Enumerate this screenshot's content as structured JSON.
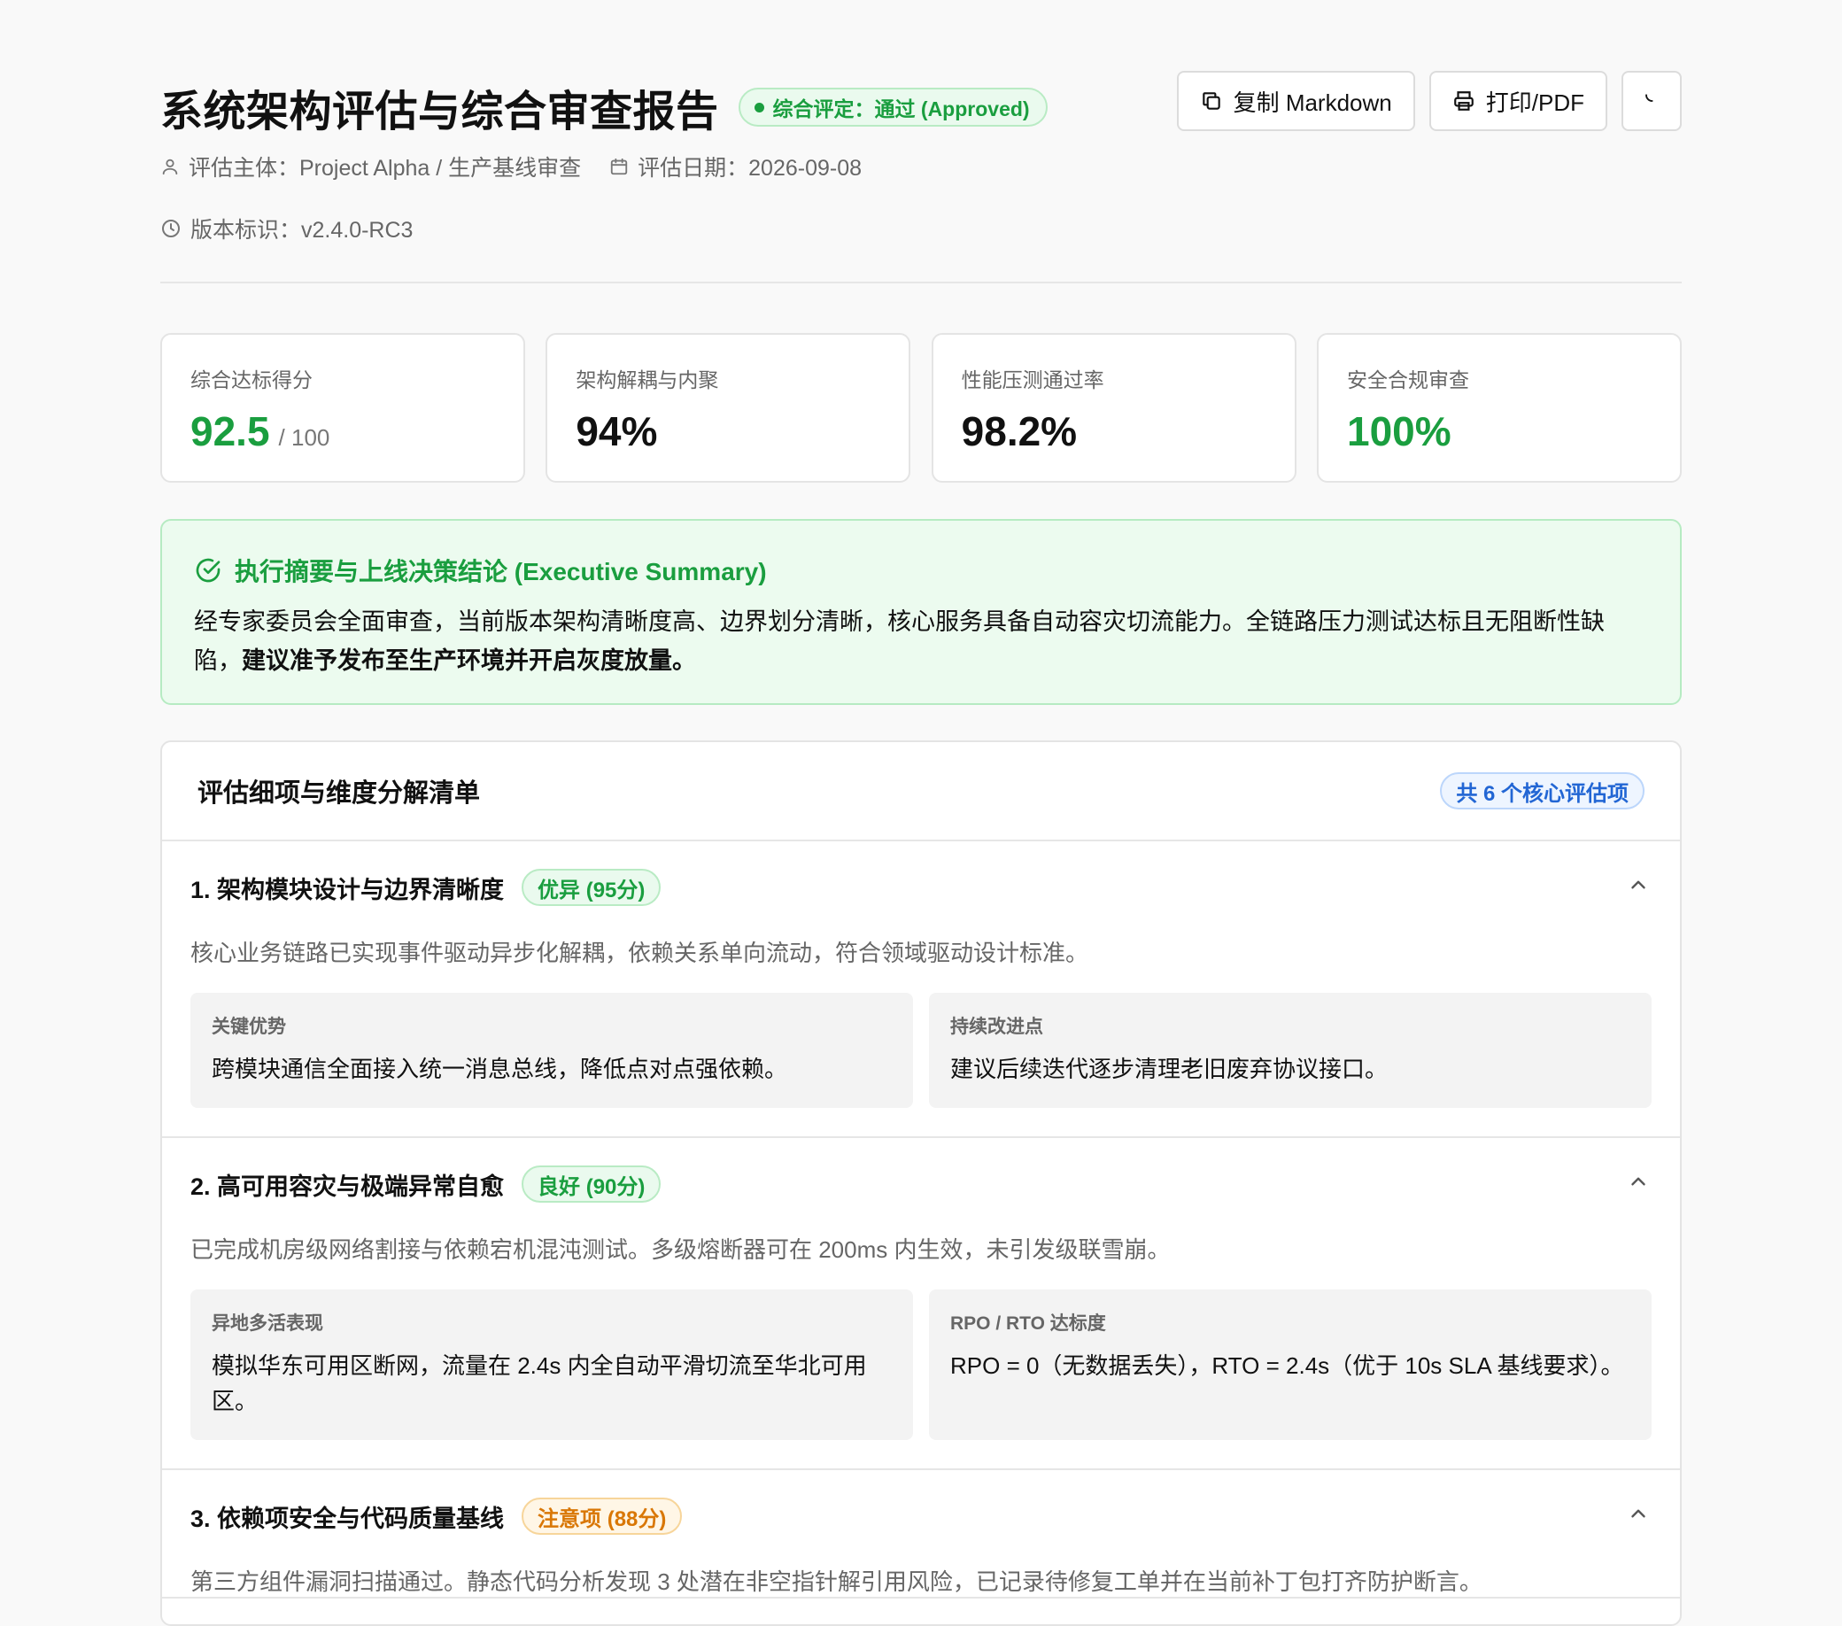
{
  "header": {
    "title": "系统架构评估与综合审查报告",
    "status": "综合评定：通过 (Approved)",
    "subject": "评估主体：Project Alpha / 生产基线审查",
    "date": "评估日期：2026-09-08",
    "version": "版本标识：v2.4.0-RC3",
    "copy_label": "复制 Markdown",
    "print_label": "打印/PDF"
  },
  "metrics": [
    {
      "label": "综合达标得分",
      "value": "92.5",
      "suffix": "/ 100"
    },
    {
      "label": "架构解耦与内聚",
      "value": "94%"
    },
    {
      "label": "性能压测通过率",
      "value": "98.2%"
    },
    {
      "label": "安全合规审查",
      "value": "100%"
    }
  ],
  "summary": {
    "title": "执行摘要与上线决策结论 (Executive Summary)",
    "text": "经专家委员会全面审查，当前版本架构清晰度高、边界划分清晰，核心服务具备自动容灾切流能力。全链路压力测试达标且无阻断性缺陷，",
    "emphasis": "建议准予发布至生产环境并开启灰度放量。"
  },
  "details": {
    "title": "评估细项与维度分解清单",
    "count": "共 6 个核心评估项",
    "items": [
      {
        "title": "1. 架构模块设计与边界清晰度",
        "grade": "优异 (95分)",
        "desc": "核心业务链路已实现事件驱动异步化解耦，依赖关系单向流动，符合领域驱动设计标准。",
        "left_label": "关键优势",
        "left_text": "跨模块通信全面接入统一消息总线，降低点对点强依赖。",
        "right_label": "持续改进点",
        "right_text": "建议后续迭代逐步清理老旧废弃协议接口。"
      },
      {
        "title": "2. 高可用容灾与极端异常自愈",
        "grade": "良好 (90分)",
        "desc": "已完成机房级网络割接与依赖宕机混沌测试。多级熔断器可在 200ms 内生效，未引发级联雪崩。",
        "left_label": "异地多活表现",
        "left_text": "模拟华东可用区断网，流量在 2.4s 内全自动平滑切流至华北可用区。",
        "right_label": "RPO / RTO 达标度",
        "right_text": "RPO = 0（无数据丢失），RTO = 2.4s（优于 10s SLA 基线要求）。"
      },
      {
        "title": "3. 依赖项安全与代码质量基线",
        "grade": "注意项 (88分)",
        "desc": "第三方组件漏洞扫描通过。静态代码分析发现 3 处潜在非空指针解引用风险，已记录待修复工单并在当前补丁包打齐防护断言。"
      }
    ]
  }
}
